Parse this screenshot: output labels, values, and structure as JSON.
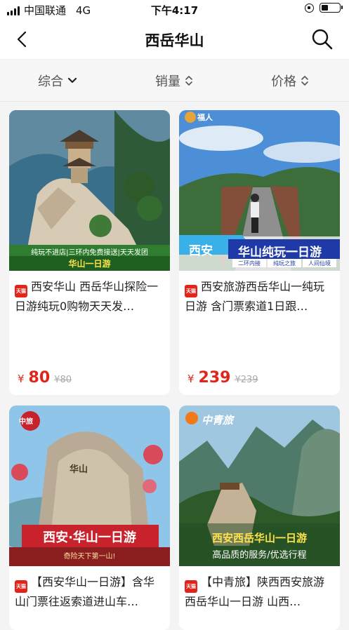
{
  "status": {
    "carrier": "中国联通",
    "network": "4G",
    "time": "下午4:17",
    "battery_level": 0.4
  },
  "nav": {
    "title": "西岳华山",
    "back_icon": "chevron-left-icon",
    "search_icon": "search-icon"
  },
  "sort": [
    {
      "label": "综合",
      "icon": "chevron-down-icon"
    },
    {
      "label": "销量",
      "icon": "sort-updown-icon"
    },
    {
      "label": "价格",
      "icon": "sort-updown-icon"
    }
  ],
  "products": [
    {
      "title": "西安华山 西岳华山探险一日游纯玩0购物天天发…",
      "badge": "天猫",
      "price": "80",
      "original_price": "¥80",
      "currency": "¥",
      "image_texts": {
        "banner": "纯玩不进店|三环内免费接送|天天发团",
        "name": "华山一日游"
      }
    },
    {
      "title": "西安旅游西岳华山一纯玩日游 含门票索道1日跟…",
      "badge": "天猫",
      "price": "239",
      "original_price": "¥239",
      "currency": "¥",
      "image_texts": {
        "logo": "福人",
        "city": "西安",
        "name": "华山纯玩一日游",
        "tags": [
          "二环内接",
          "纯玩之旅",
          "人间仙境"
        ]
      }
    },
    {
      "title": "【西安华山一日游】含华山门票往返索道进山车…",
      "badge": "天猫",
      "price": "",
      "original_price": "",
      "currency": "",
      "image_texts": {
        "logo": "中旅",
        "stone": "华山",
        "name": "西安·华山一日游",
        "slogan": "奇险天下第一山!"
      }
    },
    {
      "title": "【中青旅】陕西西安旅游西岳华山一日游 山西…",
      "badge": "天猫",
      "price": "",
      "original_price": "",
      "currency": "",
      "image_texts": {
        "logo": "中青旅",
        "name": "西安西岳华山一日游",
        "sub": "高品质的服务/优选行程"
      }
    }
  ]
}
